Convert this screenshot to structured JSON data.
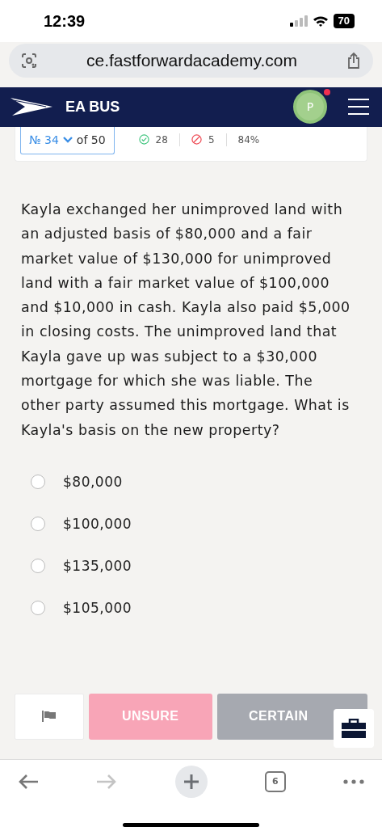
{
  "status_bar": {
    "time": "12:39",
    "battery": "70"
  },
  "browser": {
    "url": "ce.fastforwardacademy.com",
    "tab_count": "6"
  },
  "header": {
    "title": "EA BUS",
    "avatar": "P",
    "notification": true
  },
  "progress": {
    "number_prefix": "№",
    "number": "34",
    "of": "of 50",
    "correct": "28",
    "wrong": "5",
    "percent": "84%"
  },
  "question": "Kayla exchanged her unimproved land with an adjusted basis of $80,000 and a fair market value of $130,000 for unimproved land with a fair market value of $100,000 and $10,000 in cash. Kayla also paid $5,000 in closing costs. The unimproved land that Kayla gave up was subject to a $30,000 mortgage for which she was liable. The other party assumed this mortgage. What is Kayla's basis on the new property?",
  "options": [
    {
      "label": "$80,000",
      "selected": false
    },
    {
      "label": "$100,000",
      "selected": false
    },
    {
      "label": "$135,000",
      "selected": false
    },
    {
      "label": "$105,000",
      "selected": false
    }
  ],
  "buttons": [
    {
      "kind": "unsure",
      "label": "UNSURE"
    },
    {
      "kind": "certain",
      "label": "CERTAIN"
    }
  ]
}
